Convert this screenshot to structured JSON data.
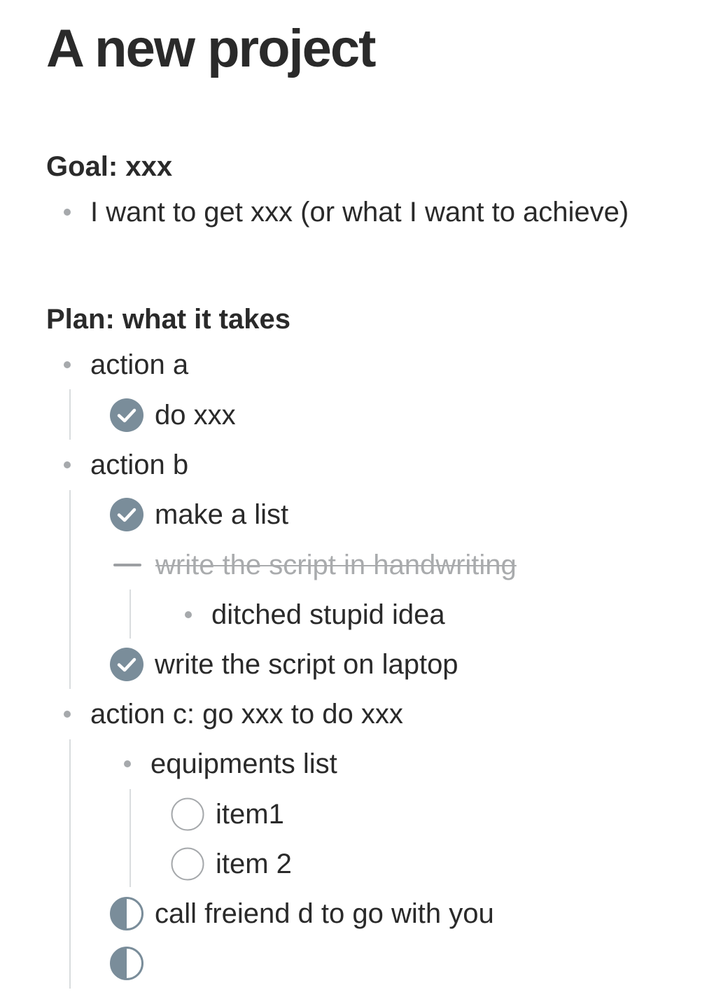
{
  "page": {
    "title": "A new project"
  },
  "goal": {
    "heading": "Goal: xxx",
    "items": [
      {
        "text": "I want to get xxx (or what I want to achieve)"
      }
    ]
  },
  "plan": {
    "heading": "Plan: what it takes",
    "action_a": {
      "label": "action a",
      "tasks": [
        {
          "text": "do xxx",
          "state": "done"
        }
      ]
    },
    "action_b": {
      "label": "action b",
      "tasks": [
        {
          "text": "make a list",
          "state": "done"
        },
        {
          "text": "write the script in handwriting",
          "state": "cancelled",
          "note": "ditched stupid idea"
        },
        {
          "text": "write the script on laptop",
          "state": "done"
        }
      ]
    },
    "action_c": {
      "label": "action c: go xxx to do xxx",
      "sub": {
        "label": "equipments list",
        "items": [
          {
            "text": "item1",
            "state": "open"
          },
          {
            "text": "item 2",
            "state": "open"
          }
        ]
      },
      "tasks": [
        {
          "text": "call freiend d to go with you",
          "state": "in-progress"
        },
        {
          "text": "",
          "state": "in-progress"
        }
      ]
    }
  },
  "colors": {
    "checkbox_fill": "#7a8d9a",
    "bullet": "#a6a9ac",
    "guide_line": "#d9dcde",
    "cancelled_text": "#a9abad"
  },
  "icons": {
    "done": "check-circle-icon",
    "open": "empty-circle-icon",
    "in_progress": "half-circle-icon",
    "cancelled": "dash-icon"
  }
}
